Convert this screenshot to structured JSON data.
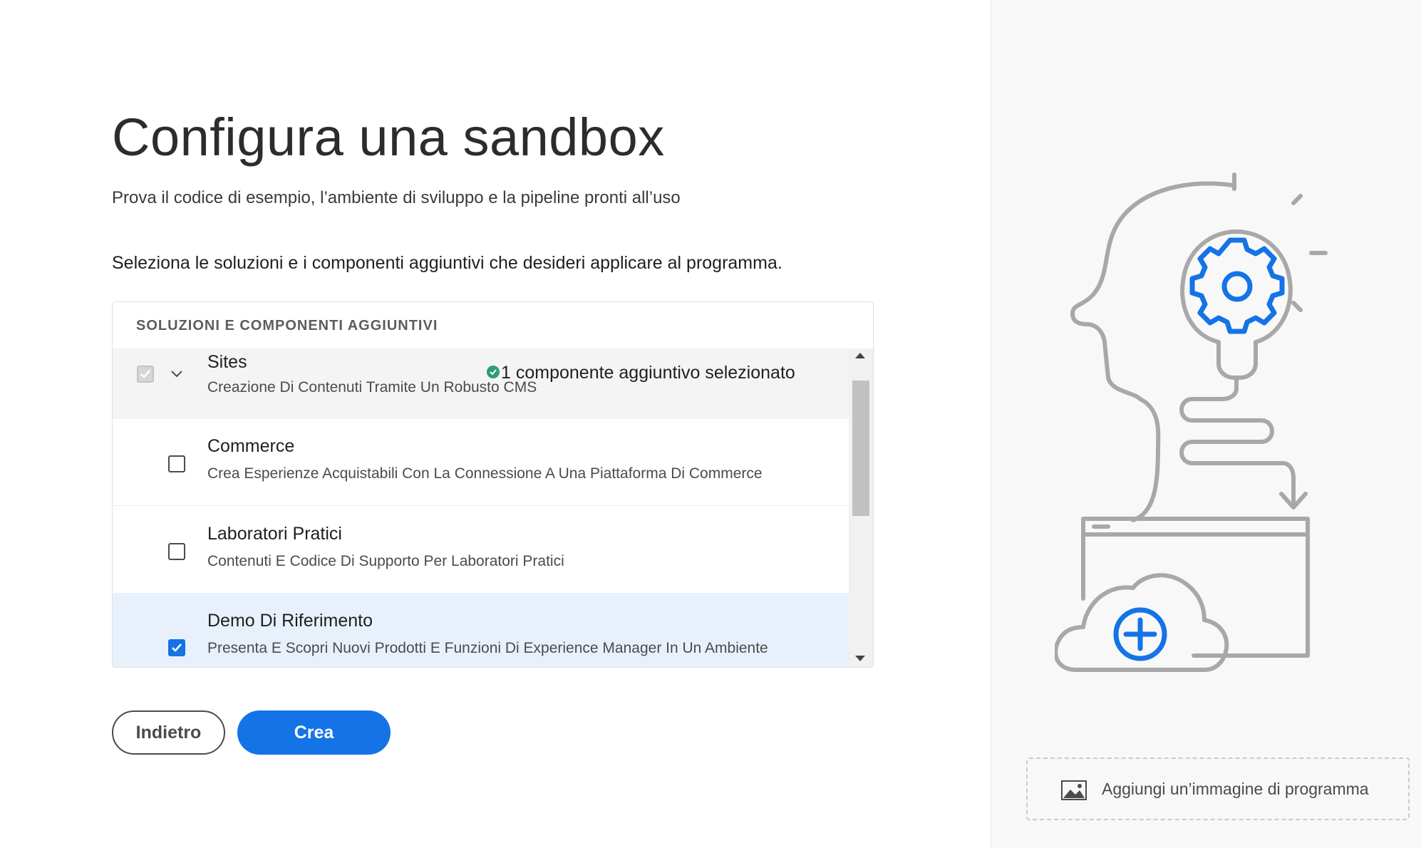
{
  "page": {
    "title": "Configura una sandbox",
    "subtitle": "Prova il codice di esempio, l’ambiente di sviluppo e la pipeline pronti all’uso",
    "instruction": "Seleziona le soluzioni e i componenti aggiuntivi che desideri applicare al programma."
  },
  "panel": {
    "header": "SOLUZIONI E COMPONENTI AGGIUNTIVI",
    "solution": {
      "name": "Sites",
      "description": "Creazione Di Contenuti Tramite Un Robusto CMS",
      "status": "1 componente aggiuntivo selezionato",
      "checked": true,
      "disabled": true,
      "expanded": true
    },
    "addons": [
      {
        "name": "Commerce",
        "description": "Crea Esperienze Acquistabili Con La Connessione A Una Piattaforma Di Commerce",
        "checked": false
      },
      {
        "name": "Laboratori Pratici",
        "description": "Contenuti E Codice Di Supporto Per Laboratori Pratici",
        "checked": false
      },
      {
        "name": "Demo Di Riferimento",
        "description": "Presenta E Scopri Nuovi Prodotti E Funzioni Di Experience Manager In Un Ambiente",
        "checked": true
      }
    ]
  },
  "buttons": {
    "back": "Indietro",
    "create": "Crea"
  },
  "side": {
    "add_image_label": "Aggiungi un’immagine di programma",
    "illustration_icons": [
      "head-icon",
      "lightbulb-icon",
      "gear-icon",
      "arrow-icon",
      "window-icon",
      "cloud-add-icon"
    ]
  },
  "colors": {
    "accent": "#1473e6",
    "success": "#2d9d78",
    "selected_row": "#e8f1fb",
    "illustration_stroke": "#a8a8a8"
  }
}
